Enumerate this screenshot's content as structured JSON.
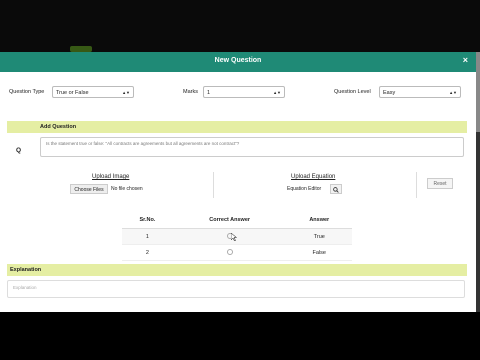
{
  "modal": {
    "title": "New Question",
    "close_glyph": "×",
    "accent_color": "#1f8a76",
    "bar_color": "#e5eea3"
  },
  "fields": {
    "question_type_label": "Question Type",
    "question_type_value": "True or False",
    "marks_label": "Marks",
    "marks_value": "1",
    "question_level_label": "Question Level",
    "question_level_value": "Easy"
  },
  "add_question": {
    "heading": "Add Question",
    "icon_label": "Q",
    "text": "Is the statement true or false: \"All contracts are agreements but all agreements are not contract\"?"
  },
  "upload": {
    "image_title": "Upload Image",
    "choose_button": "Choose Files",
    "no_file_text": "No file chosen",
    "equation_title": "Upload Equation",
    "equation_editor_label": "Equation Editor",
    "equation_icon": "search-icon",
    "reset_button": "Reset"
  },
  "answers": {
    "headers": [
      "Sr.No.",
      "Correct Answer",
      "Answer"
    ],
    "rows": [
      {
        "sr": "1",
        "answer": "True"
      },
      {
        "sr": "2",
        "answer": "False"
      }
    ]
  },
  "explanation": {
    "heading": "Explanation",
    "placeholder": "Explanation"
  }
}
